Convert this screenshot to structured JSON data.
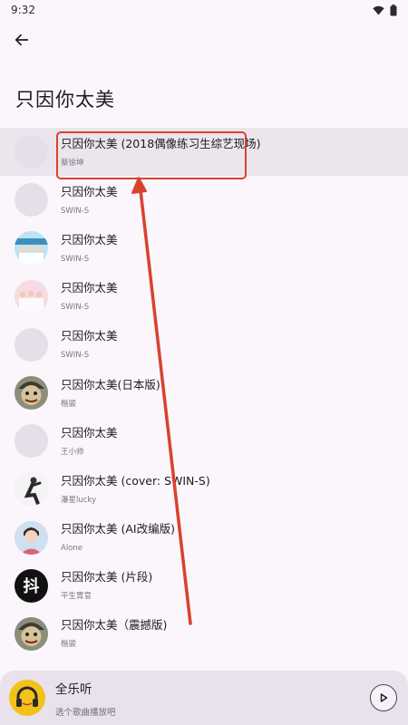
{
  "status_bar": {
    "time": "9:32"
  },
  "page": {
    "title": "只因你太美"
  },
  "songs": [
    {
      "title": "只因你太美 (2018偶像练习生综艺现场)",
      "artist": "蔡徐坤",
      "avatar": "blank",
      "selected": true
    },
    {
      "title": "只因你太美",
      "artist": "SWIN-S",
      "avatar": "blank"
    },
    {
      "title": "只因你太美",
      "artist": "SWIN-S",
      "avatar": "group-photo-blue"
    },
    {
      "title": "只因你太美",
      "artist": "SWIN-S",
      "avatar": "group-photo-pink"
    },
    {
      "title": "只因你太美",
      "artist": "SWIN-S",
      "avatar": "blank"
    },
    {
      "title": "只因你太美(日本版)",
      "artist": "楷骏",
      "avatar": "cartoon-face"
    },
    {
      "title": "只因你太美",
      "artist": "王小帅",
      "avatar": "blank"
    },
    {
      "title": "只因你太美 (cover: SWIN-S)",
      "artist": "瀑星lucky",
      "avatar": "dancer-photo"
    },
    {
      "title": "只因你太美 (AI改编版)",
      "artist": "Alone",
      "avatar": "portrait-photo"
    },
    {
      "title": "只因你太美 (片段)",
      "artist": "平生胃意",
      "avatar": "douyin-logo",
      "avatar_text": "抖"
    },
    {
      "title": "只因你太美（震撼版)",
      "artist": "楷骏",
      "avatar": "cartoon-face"
    }
  ],
  "player": {
    "title": "全乐听",
    "subtitle": "选个歌曲播放吧",
    "art_icon": "headphones-icon",
    "play_icon": "play-icon"
  },
  "colors": {
    "background": "#fbf6fc",
    "selected_row": "#ebe5ee",
    "annotation_red": "#d8422f",
    "player_bg": "#e9e2ec"
  }
}
